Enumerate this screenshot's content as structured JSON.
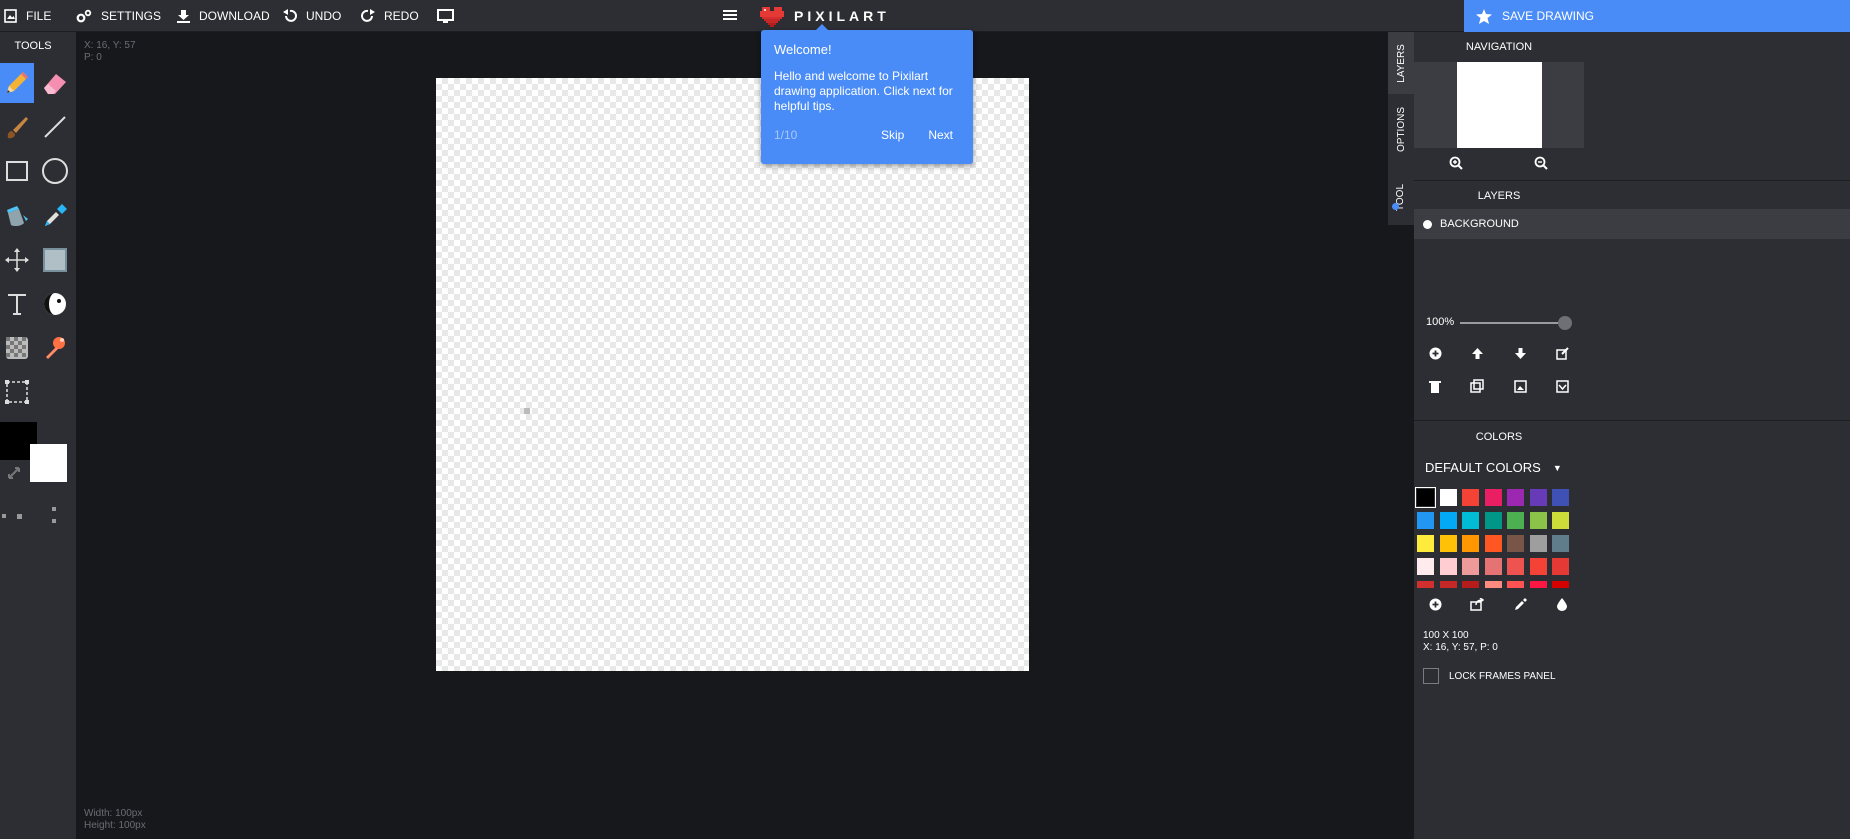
{
  "topbar": {
    "file_label": "FILE",
    "settings_label": "SETTINGS",
    "download_label": "DOWNLOAD",
    "undo_label": "UNDO",
    "redo_label": "REDO",
    "brand": "PIXILART",
    "save_label": "SAVE DRAWING"
  },
  "tools": {
    "title": "TOOLS",
    "items": [
      "pencil",
      "eraser",
      "brush",
      "line",
      "rectangle",
      "ellipse",
      "bucket",
      "eyedropper",
      "move",
      "select-fill",
      "text",
      "shading",
      "dither",
      "stamp",
      "selection"
    ],
    "primary_color": "#000000",
    "secondary_color": "#ffffff"
  },
  "canvas": {
    "cursor_info": "X: 16, Y: 57",
    "pixel_info": "P: 0",
    "width_info": "Width: 100px",
    "height_info": "Height: 100px"
  },
  "tour": {
    "title": "Welcome!",
    "body": "Hello and welcome to Pixilart drawing application. Click next for helpful tips.",
    "step": "1/10",
    "skip_label": "Skip",
    "next_label": "Next"
  },
  "side_tabs": {
    "layers": "LAYERS",
    "options": "OPTIONS",
    "tool": "TOOL"
  },
  "panel": {
    "navigation_title": "NAVIGATION",
    "layers_title": "LAYERS",
    "layer_name": "BACKGROUND",
    "opacity": "100%",
    "colors_title": "COLORS",
    "palette_name": "DEFAULT COLORS",
    "size_info": "100 X 100",
    "coord_info": "X: 16, Y: 57, P: 0",
    "lock_label": "LOCK FRAMES PANEL",
    "palette": [
      "#000000",
      "#ffffff",
      "#f44336",
      "#e91e63",
      "#9c27b0",
      "#673ab7",
      "#3f51b5",
      "#2196f3",
      "#03a9f4",
      "#00bcd4",
      "#009688",
      "#4caf50",
      "#8bc34a",
      "#cddc39",
      "#ffeb3b",
      "#ffc107",
      "#ff9800",
      "#ff5722",
      "#795548",
      "#9e9e9e",
      "#607d8b",
      "#ffebee",
      "#ffcdd2",
      "#ef9a9a",
      "#e57373",
      "#ef5350",
      "#f44336",
      "#e53935",
      "#d32f2f",
      "#c62828",
      "#b71c1c",
      "#ff8a80",
      "#ff5252",
      "#ff1744",
      "#d50000"
    ]
  },
  "accent": "#4a8cf7"
}
